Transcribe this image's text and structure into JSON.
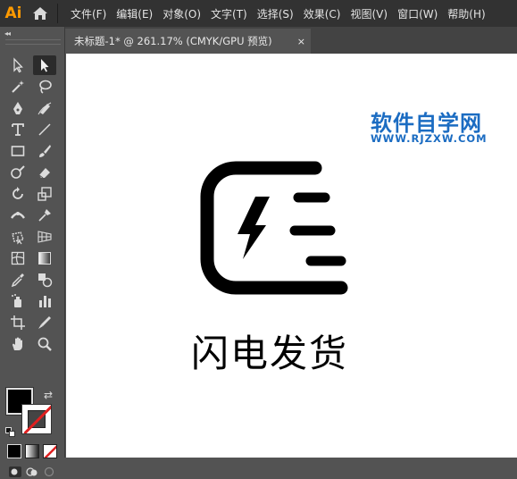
{
  "app": {
    "logo_text": "Ai",
    "menu": [
      {
        "label": "文件(F)"
      },
      {
        "label": "编辑(E)"
      },
      {
        "label": "对象(O)"
      },
      {
        "label": "文字(T)"
      },
      {
        "label": "选择(S)"
      },
      {
        "label": "效果(C)"
      },
      {
        "label": "视图(V)"
      },
      {
        "label": "窗口(W)"
      },
      {
        "label": "帮助(H)"
      }
    ]
  },
  "document_tab": {
    "title": "未标题-1* @ 261.17% (CMYK/GPU 预览)",
    "close_glyph": "×"
  },
  "toolpanel": {
    "collapse_glyph": "◂◂",
    "swap_glyph": "⇄"
  },
  "canvas": {
    "watermark_title": "软件自学网",
    "watermark_url": "WWW.RJZXW.COM",
    "caption": "闪电发货"
  },
  "colors": {
    "accent": "#FF9A00",
    "watermark": "#1b6cc2",
    "fill": "#000000",
    "stroke_none": "#e02020"
  }
}
